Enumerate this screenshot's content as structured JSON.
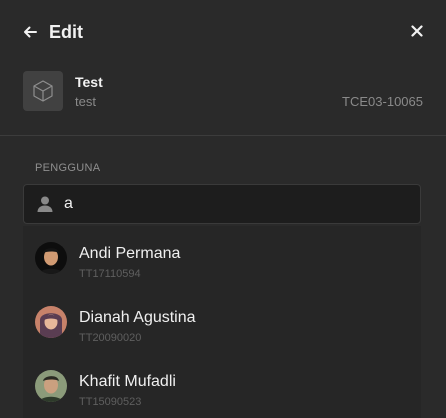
{
  "header": {
    "title": "Edit",
    "back_icon": "arrow-left-icon",
    "close_icon": "close-icon"
  },
  "product": {
    "name": "Test",
    "subtitle": "test",
    "code": "TCE03-10065",
    "thumbnail_icon": "cube-icon"
  },
  "user_section": {
    "label": "PENGGUNA",
    "search": {
      "value": "a",
      "icon": "user-icon"
    }
  },
  "results": [
    {
      "name": "Andi Permana",
      "code": "TT17110594"
    },
    {
      "name": "Dianah Agustina",
      "code": "TT20090020"
    },
    {
      "name": "Khafit Mufadli",
      "code": "TT15090523"
    }
  ],
  "colors": {
    "background": "#2a2a2a",
    "input_background": "#1d1d1d",
    "dropdown_background": "#262626"
  }
}
